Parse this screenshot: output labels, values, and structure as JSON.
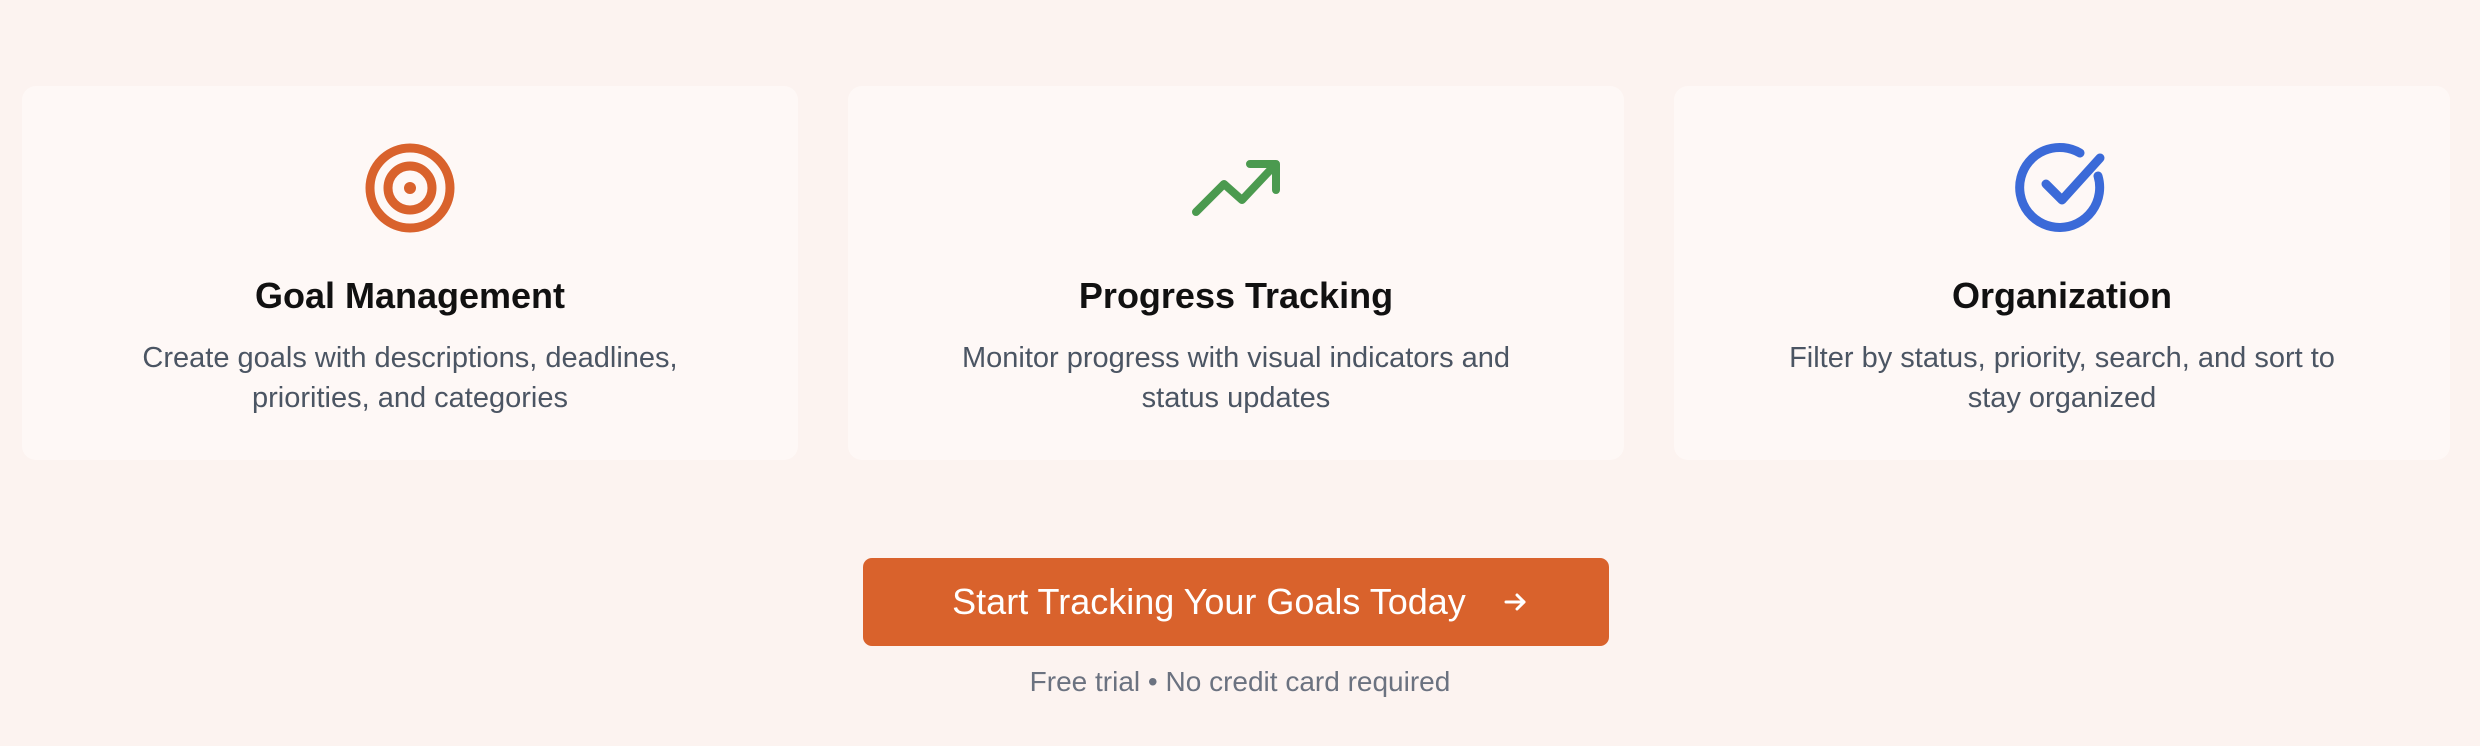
{
  "features": [
    {
      "icon": "target-icon",
      "title": "Goal Management",
      "description": "Create goals with descriptions, deadlines, priorities, and categories",
      "color": "#d9622c"
    },
    {
      "icon": "trending-up-icon",
      "title": "Progress Tracking",
      "description": "Monitor progress with visual indicators and status updates",
      "color": "#4b9a4f"
    },
    {
      "icon": "check-circle-icon",
      "title": "Organization",
      "description": "Filter by status, priority, search, and sort to stay organized",
      "color": "#3b6ad8"
    }
  ],
  "cta": {
    "label": "Start Tracking Your Goals Today",
    "icon": "arrow-right-icon",
    "color": "#d9622c",
    "note": "Free trial • No credit card required"
  }
}
